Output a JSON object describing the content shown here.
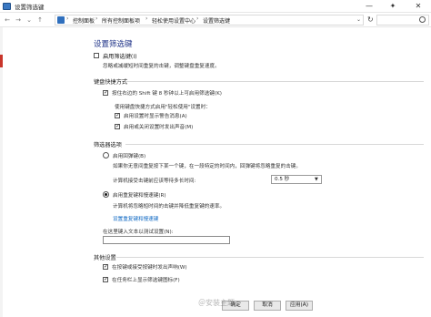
{
  "window": {
    "title": "设置筛选键",
    "controls": {
      "minimize": "—",
      "pin": "✦",
      "close": "✕"
    }
  },
  "addressbar": {
    "breadcrumbs": [
      "控制面板",
      "所有控制面板项",
      "轻松使用设置中心",
      "设置筛选键"
    ],
    "separator": "›",
    "dropdown": "⌄",
    "refresh": "↻"
  },
  "page": {
    "title": "设置筛选键",
    "enable_filterkeys": {
      "label": "启用筛选键(I)",
      "checked": false
    },
    "enable_desc": "忽略或减缓短时间重复的击键，调整键盘重复速度。",
    "shortcut_section": "键盘快捷方式",
    "shortcut_checkbox": {
      "label": "按住右边的 Shift 键 8 秒钟以上可启用筛选键(K)",
      "checked": true
    },
    "shortcut_sub_desc": "使用键盘快捷方式启用\"轻松使用\"设置时：",
    "show_warning": {
      "label": "启用设置时显示警告消息(A)",
      "checked": true
    },
    "make_sound": {
      "label": "启用或关闭设置时发出声音(M)",
      "checked": true
    },
    "filter_section": "筛选器选项",
    "bouncekeys": {
      "label": "启用回弹键(B)",
      "selected": false
    },
    "bouncekeys_desc": "如果你无意间重复按下某一个键，在一段特定的时间内，回弹键将忽略重复的击键。",
    "delay_label": "计算机接受击键前应该等待多长时间:",
    "delay_value": "0.5 秒",
    "repeat_keys": {
      "label": "启用重复键和慢速键(R)",
      "selected": true
    },
    "repeat_desc": "计算机将忽略短时间的击键并降低重复键的速率。",
    "repeat_link": "设置重复键和慢速键",
    "test_label": "在这里键入文本以测试设置(N):",
    "test_value": "",
    "other_section": "其他设置",
    "beep": {
      "label": "在按键或接受按键时发出声响(W)",
      "checked": true
    },
    "taskbar_icon": {
      "label": "在任务栏上显示筛选键图标(F)",
      "checked": true
    }
  },
  "buttons": {
    "ok": "确定",
    "cancel": "取消",
    "apply": "应用(A)"
  },
  "watermark": "＠安装主题",
  "colors": {
    "heading": "#1e3287",
    "link": "#0b66c2",
    "accent": "#c8352a"
  }
}
